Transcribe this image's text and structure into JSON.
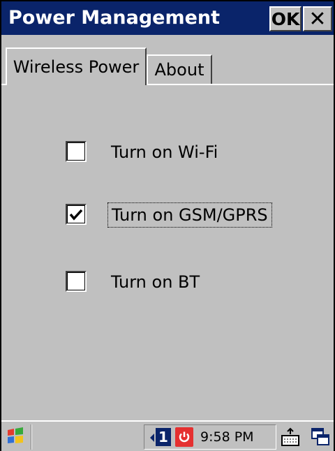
{
  "window": {
    "title": "Power Management",
    "ok_label": "OK",
    "close_glyph": "✕"
  },
  "tabs": [
    {
      "label": "Wireless Power",
      "selected": true
    },
    {
      "label": "About",
      "selected": false
    }
  ],
  "options": [
    {
      "label": "Turn on Wi-Fi",
      "checked": false,
      "focused": false
    },
    {
      "label": "Turn on GSM/GPRS",
      "checked": true,
      "focused": true
    },
    {
      "label": "Turn on BT",
      "checked": false,
      "focused": false
    }
  ],
  "taskbar": {
    "start_icon": "windows-flag-icon",
    "tray_number": "1",
    "time": "9:58 PM",
    "keyboard_icon": "keyboard-icon",
    "task_icon": "task-switch-icon"
  },
  "colors": {
    "title_bar": "#0a246a",
    "dialog_bg": "#c0c0c0",
    "power_red": "#e53030"
  }
}
